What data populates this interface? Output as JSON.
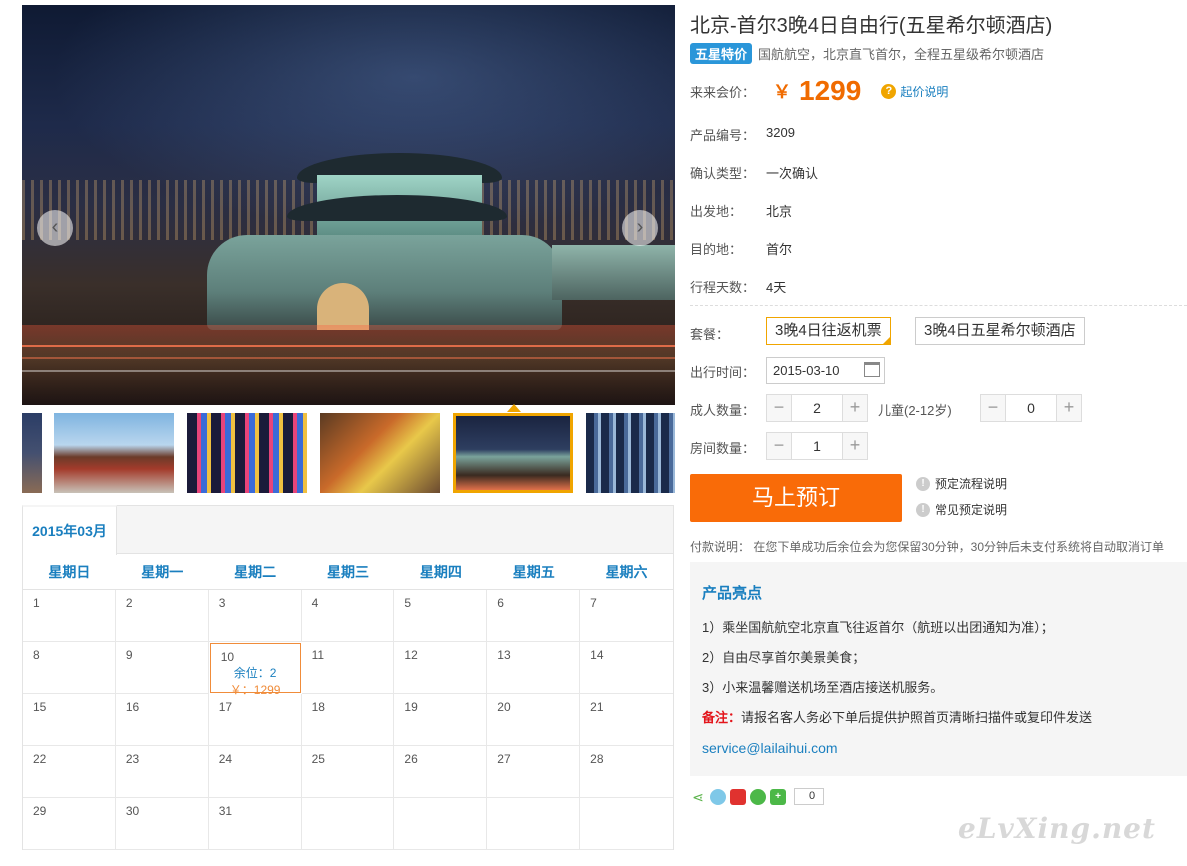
{
  "gallery": {
    "prev_arrow": "‹",
    "next_arrow": "›",
    "thumbs": [
      "thumb-1",
      "thumb-2",
      "thumb-3",
      "thumb-4",
      "thumb-5",
      "thumb-6"
    ]
  },
  "calendar": {
    "month_tab": "2015年03月",
    "weekdays": [
      "星期日",
      "星期一",
      "星期二",
      "星期三",
      "星期四",
      "星期五",
      "星期六"
    ],
    "days": [
      "1",
      "2",
      "3",
      "4",
      "5",
      "6",
      "7",
      "8",
      "9",
      "10",
      "11",
      "12",
      "13",
      "14",
      "15",
      "16",
      "17",
      "18",
      "19",
      "20",
      "21",
      "22",
      "23",
      "24",
      "25",
      "26",
      "27",
      "28",
      "29",
      "30",
      "31",
      "",
      "",
      "",
      ""
    ],
    "available": {
      "day": "10",
      "stock": "余位：2",
      "price": "￥：1299"
    }
  },
  "product": {
    "title": "北京-首尔3晚4日自由行(五星希尔顿酒店)",
    "badge": "五星特价",
    "subtitle": "国航航空，北京直飞首尔，全程五星级希尔顿酒店",
    "price_label": "来来会价：",
    "currency": "￥",
    "price": "1299",
    "price_help_icon": "?",
    "price_help": "起价说明",
    "info": [
      {
        "label": "产品编号：",
        "value": "3209"
      },
      {
        "label": "确认类型：",
        "value": "一次确认"
      },
      {
        "label": "出发地：",
        "value": "北京"
      },
      {
        "label": "目的地：",
        "value": "首尔"
      },
      {
        "label": "行程天数：",
        "value": "4天"
      }
    ]
  },
  "booking": {
    "package_label": "套餐：",
    "packages": [
      "3晚4日往返机票",
      "3晚4日五星希尔顿酒店"
    ],
    "date_label": "出行时间：",
    "date_value": "2015-03-10",
    "adult_label": "成人数量：",
    "adult_count": "2",
    "child_label": "儿童(2-12岁)",
    "child_count": "0",
    "room_label": "房间数量：",
    "room_count": "1",
    "minus": "−",
    "plus": "+",
    "book_button": "马上预订",
    "help_links": [
      "预定流程说明",
      "常见预定说明"
    ],
    "help_icon": "!",
    "payment_note": "付款说明： 在您下单成功后余位会为您保留30分钟，30分钟后未支付系统将自动取消订单"
  },
  "highlights": {
    "title": "产品亮点",
    "items": [
      "1）乘坐国航航空北京直飞往返首尔（航班以出团通知为准）；",
      "2）自由尽享首尔美景美食；",
      "3）小来温馨赠送机场至酒店接送机服务。"
    ],
    "note_label": "备注：",
    "note_text": "请报名客人务必下单后提供护照首页清晰扫描件或复印件发送",
    "email": "service@lailaihui.com"
  },
  "share": {
    "count": "0"
  },
  "watermark": "eLvXing.net"
}
